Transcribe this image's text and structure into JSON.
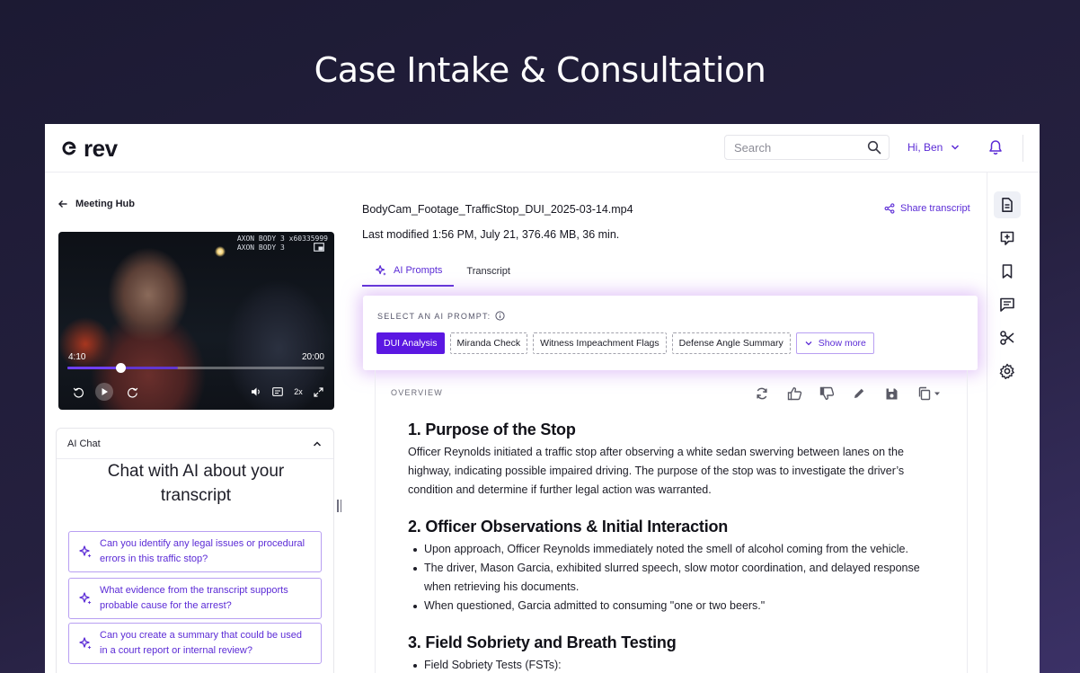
{
  "hero": {
    "title": "Case Intake & Consultation"
  },
  "header": {
    "logo_text": "rev",
    "search_placeholder": "Search",
    "user_greeting": "Hi, Ben"
  },
  "left": {
    "back_label": "Meeting Hub",
    "video": {
      "overlay_line1": "AXON BODY 3 x60335999",
      "overlay_line2": "AXON BODY 3",
      "current_time": "4:10",
      "duration": "20:00",
      "progress_fraction": 0.208,
      "buffered_fraction": 0.43,
      "speed_label": "2x"
    },
    "ai_chat": {
      "title": "AI Chat",
      "heading": "Chat with AI about your transcript",
      "suggestions": [
        "Can you identify any legal issues or procedural errors in this traffic stop?",
        "What evidence from the transcript supports probable cause for the arrest?",
        "Can you create a summary that could be used in a court report or internal review?"
      ]
    }
  },
  "main": {
    "file_name": "BodyCam_Footage_TrafficStop_DUI_2025-03-14.mp4",
    "meta": "Last modified 1:56 PM, July 21, 376.46 MB, 36 min.",
    "share_label": "Share transcript",
    "tabs": [
      {
        "label": "AI Prompts",
        "active": true
      },
      {
        "label": "Transcript",
        "active": false
      }
    ],
    "prompt_label": "SELECT AN AI PROMPT:",
    "prompts": [
      {
        "label": "DUI Analysis",
        "active": true
      },
      {
        "label": "Miranda Check",
        "active": false
      },
      {
        "label": "Witness Impeachment Flags",
        "active": false
      },
      {
        "label": "Defense Angle Summary",
        "active": false
      }
    ],
    "show_more_label": "Show more",
    "overview_label": "OVERVIEW",
    "sections": {
      "s1_title": "1. Purpose of the Stop",
      "s1_body": "Officer Reynolds initiated a traffic stop after observing a white sedan swerving between lanes on the highway, indicating possible impaired driving. The purpose of the stop was to investigate the driver’s condition and determine if further legal action was warranted.",
      "s2_title": "2. Officer Observations & Initial Interaction",
      "s2_bullets": [
        "Upon approach, Officer Reynolds immediately noted the smell of alcohol coming from the vehicle.",
        "The driver, Mason Garcia, exhibited slurred speech, slow motor coordination, and delayed response when retrieving his documents.",
        "When questioned, Garcia admitted to consuming \"one or two beers.\""
      ],
      "s3_title": "3. Field Sobriety and Breath Testing",
      "s3_bullets": [
        "Field Sobriety Tests (FSTs):"
      ]
    }
  },
  "colors": {
    "accent": "#5b2bd6",
    "accent_fill": "#5b17e2",
    "background": "#1c1a33"
  }
}
